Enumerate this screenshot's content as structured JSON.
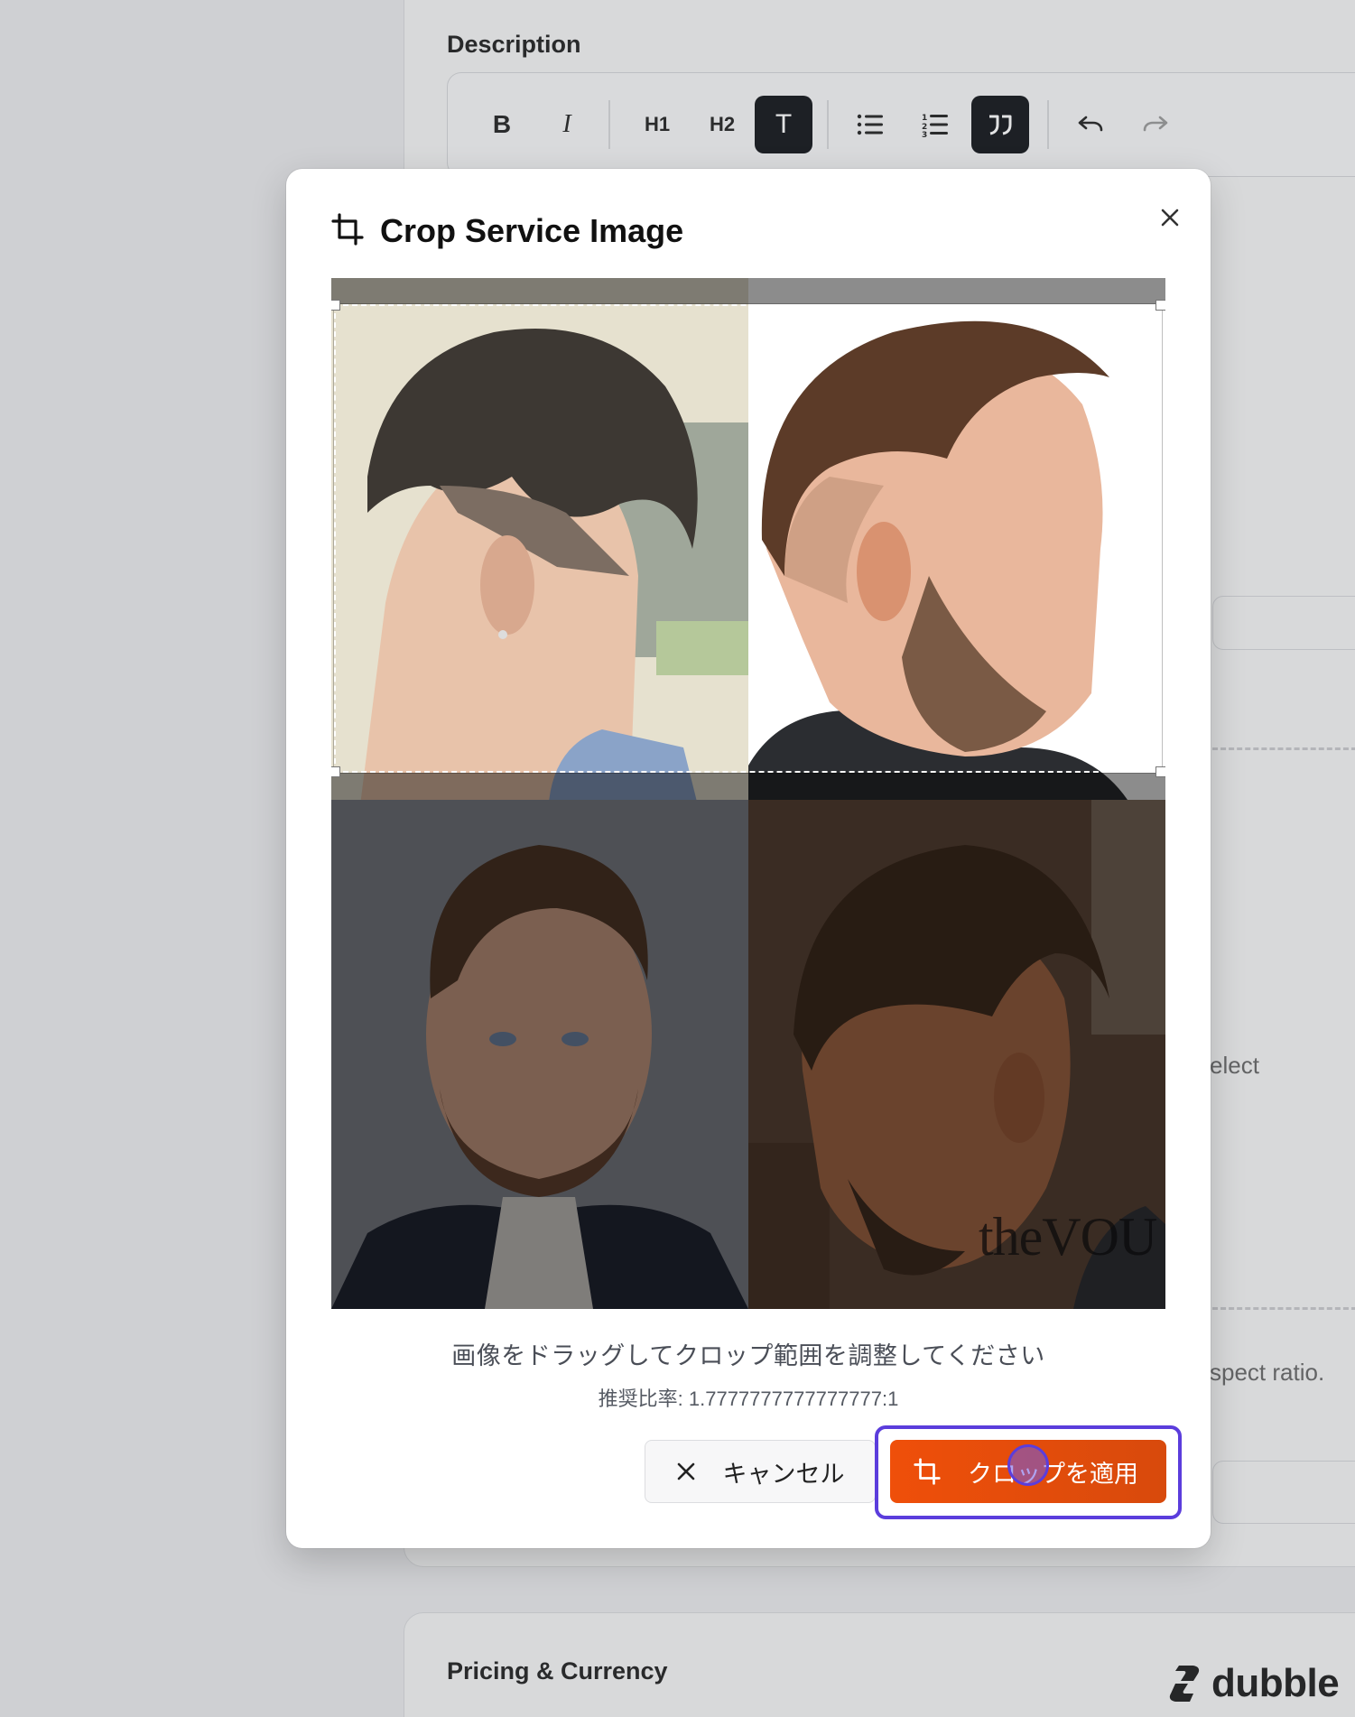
{
  "background": {
    "description_label": "Description",
    "toolbar": {
      "bold": "B",
      "italic": "I",
      "h1": "H1",
      "h2": "H2",
      "text": "T",
      "bullet_list_icon": "bullet-list-icon",
      "ordered_list_icon": "ordered-list-icon",
      "quote_icon": "quote-icon",
      "undo_icon": "undo-icon",
      "redo_icon": "redo-icon"
    },
    "partial_text_select": "elect",
    "partial_text_aspect": "spect ratio.",
    "pricing_label": "Pricing & Currency",
    "brand": "dubble"
  },
  "modal": {
    "title": "Crop Service Image",
    "title_icon": "crop-icon",
    "close_icon": "close-icon",
    "watermark": "theVOU",
    "hint": "画像をドラッグしてクロップ範囲を調整してください",
    "ratio": "推奨比率: 1.7777777777777777:1",
    "cancel_label": "キャンセル",
    "apply_label": "クロップを適用",
    "colors": {
      "apply_bg": "#e84e0b",
      "focus_ring": "#5b3ddc"
    }
  }
}
